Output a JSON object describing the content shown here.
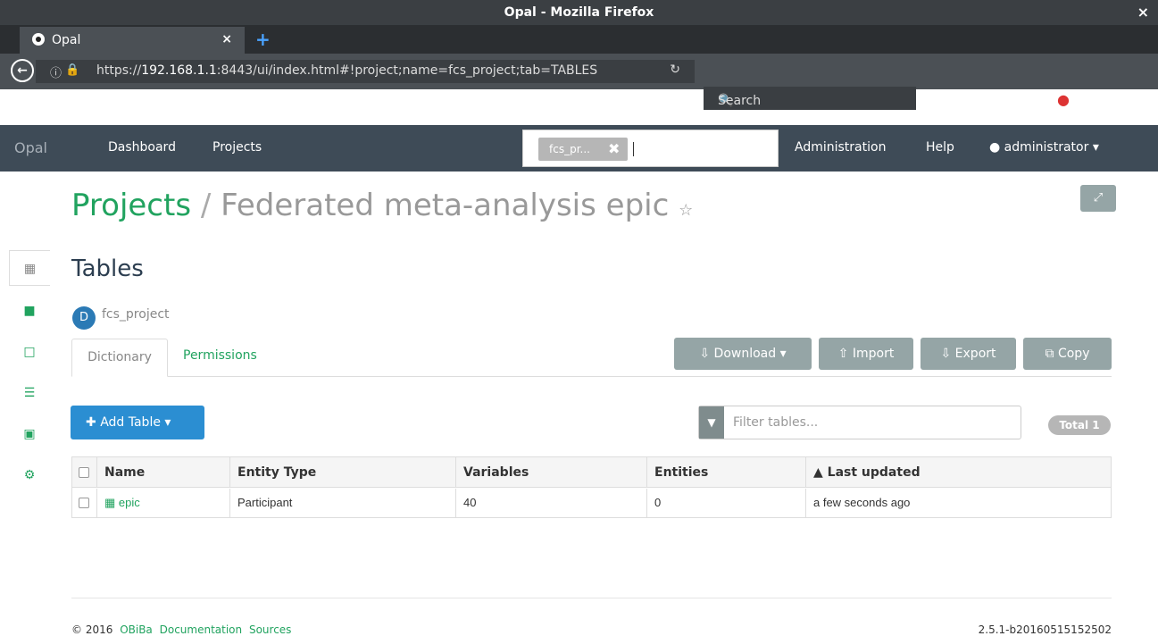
{
  "window": {
    "title": "Opal - Mozilla Firefox",
    "close": "×"
  },
  "browser": {
    "tab_label": "Opal",
    "tab_close": "×",
    "new_tab": "+",
    "url_prefix": "https://",
    "url_host": "192.168.1.1",
    "url_rest": ":8443/ui/index.html#!project;name=fcs_project;tab=TABLES",
    "search_placeholder": "Search"
  },
  "appnav": {
    "brand": "Opal",
    "dashboard": "Dashboard",
    "projects": "Projects",
    "search_chip": "fcs_pr...",
    "administration": "Administration",
    "help": "Help",
    "user": "administrator"
  },
  "page": {
    "breadcrumb_projects": "Projects",
    "breadcrumb_sep": "/",
    "project_title": "Federated meta-analysis epic",
    "section_title": "Tables",
    "datasource_badge": "D",
    "datasource_name": "fcs_project"
  },
  "tabs": {
    "dictionary": "Dictionary",
    "permissions": "Permissions"
  },
  "actions": {
    "download": "Download",
    "import": "Import",
    "export": "Export",
    "copy": "Copy",
    "add_table": "Add Table",
    "filter_placeholder": "Filter tables...",
    "total": "Total 1"
  },
  "table": {
    "headers": {
      "name": "Name",
      "entity_type": "Entity Type",
      "variables": "Variables",
      "entities": "Entities",
      "last_updated": "Last updated"
    },
    "rows": [
      {
        "name": "epic",
        "entity_type": "Participant",
        "variables": "40",
        "entities": "0",
        "last_updated": "a few seconds ago"
      }
    ]
  },
  "footer": {
    "copyright": "© 2016",
    "obiba": "OBiBa",
    "documentation": "Documentation",
    "sources": "Sources",
    "version": "2.5.1-b20160515152502"
  },
  "colors": {
    "brand_green": "#21a35f",
    "navbar": "#3e4b57",
    "primary_blue": "#2b8ed2",
    "gray_button": "#95a5a6"
  }
}
